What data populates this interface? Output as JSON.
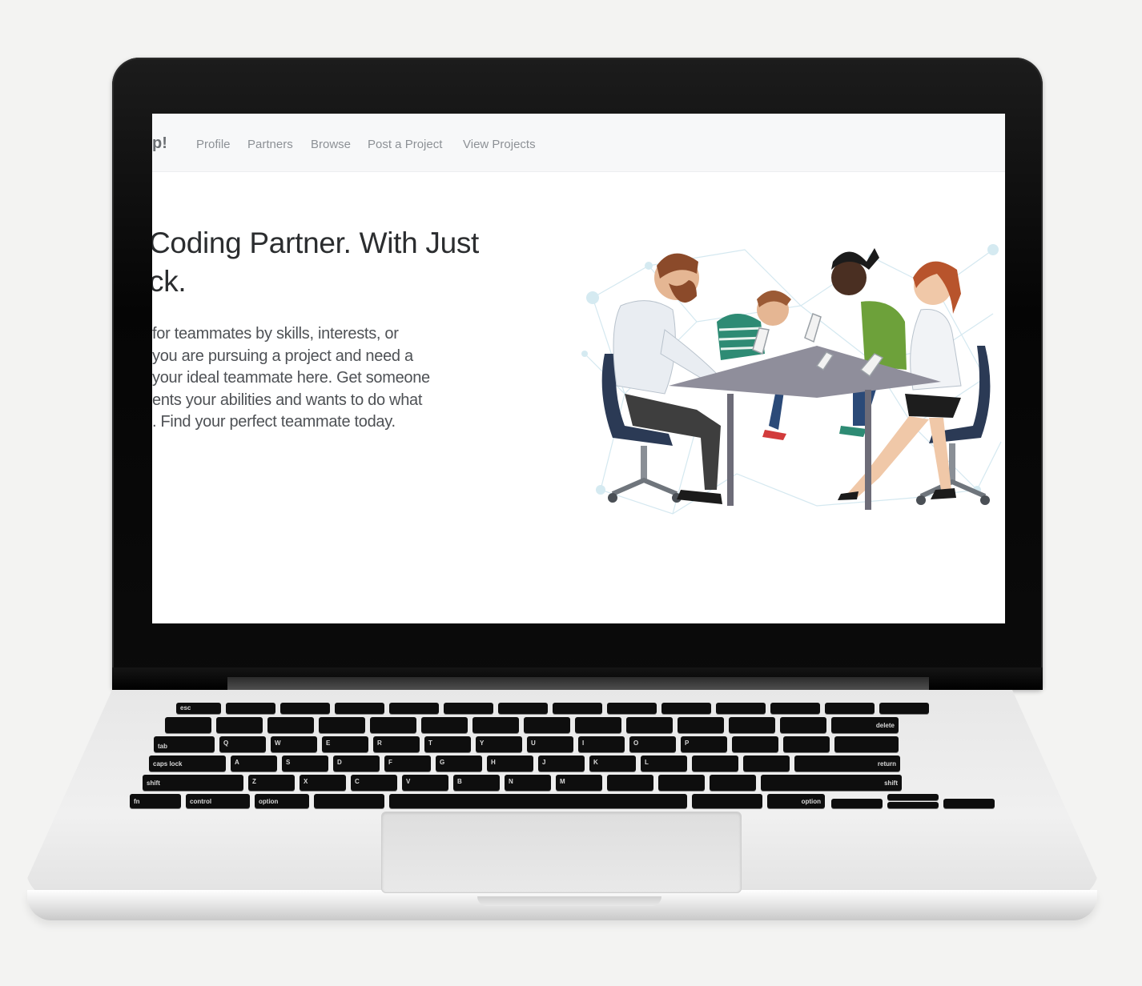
{
  "navbar": {
    "brand": "p!",
    "links": [
      "Profile",
      "Partners",
      "Browse",
      "Post a Project",
      "View Projects"
    ]
  },
  "hero": {
    "title_lines": [
      "Coding Partner. With Just",
      "ck."
    ],
    "body_lines": [
      "for teammates by skills, interests, or",
      "you are pursuing a project and need a",
      "your ideal teammate here. Get someone",
      "ents your abilities and wants to do what",
      ". Find your perfect teammate today."
    ]
  },
  "keyboard": {
    "labels": [
      "esc",
      "tab",
      "caps lock",
      "shift",
      "fn",
      "control",
      "option",
      "option",
      "delete",
      "return",
      "shift",
      "Q",
      "W",
      "E",
      "R",
      "T",
      "Y",
      "U",
      "I",
      "O",
      "P",
      "A",
      "S",
      "D",
      "F",
      "G",
      "H",
      "J",
      "K",
      "L",
      "Z",
      "X",
      "C",
      "V",
      "B",
      "N",
      "M"
    ]
  },
  "colors": {
    "screen_bg": "#ffffff",
    "navbar_bg": "#f7f8f9",
    "nav_link": "#8d9196",
    "title_text": "#2b2d2f",
    "body_text": "#4e5155",
    "bezel": "#050505",
    "keys": "#0e0e0e",
    "chassis": "#e7e7e7"
  }
}
